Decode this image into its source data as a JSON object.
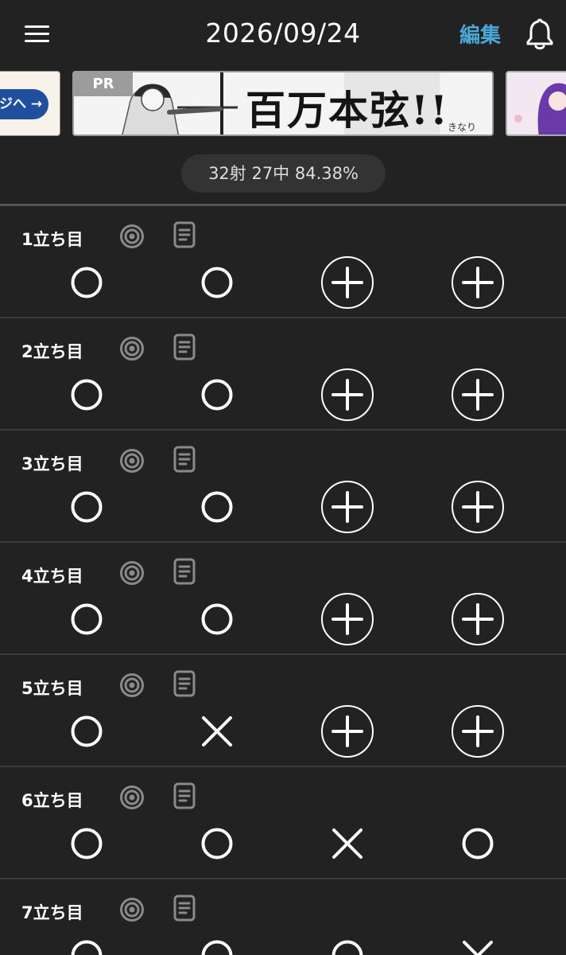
{
  "header": {
    "title": "2026/09/24",
    "edit_label": "編集",
    "menu_icon": "hamburger-menu-icon",
    "bell_icon": "bell-icon"
  },
  "ads": {
    "left_text": "ジへ →",
    "main_pr": "PR",
    "main_title": "百万本弦!!",
    "main_signature": "きなり"
  },
  "stats": {
    "text": "32射 27中 84.38%"
  },
  "colors": {
    "background": "#222222",
    "accent": "#4aa8d8",
    "icon_gray": "#8a8a8a",
    "divider": "#3c3c3c"
  },
  "rounds": [
    {
      "label": "1立ち目",
      "shots": [
        "hit",
        "hit",
        "empty",
        "empty"
      ]
    },
    {
      "label": "2立ち目",
      "shots": [
        "hit",
        "hit",
        "empty",
        "empty"
      ]
    },
    {
      "label": "3立ち目",
      "shots": [
        "hit",
        "hit",
        "empty",
        "empty"
      ]
    },
    {
      "label": "4立ち目",
      "shots": [
        "hit",
        "hit",
        "empty",
        "empty"
      ]
    },
    {
      "label": "5立ち目",
      "shots": [
        "hit",
        "miss",
        "empty",
        "empty"
      ]
    },
    {
      "label": "6立ち目",
      "shots": [
        "hit",
        "hit",
        "miss",
        "hit"
      ]
    },
    {
      "label": "7立ち目",
      "shots": [
        "hit",
        "hit",
        "hit",
        "miss"
      ]
    }
  ]
}
